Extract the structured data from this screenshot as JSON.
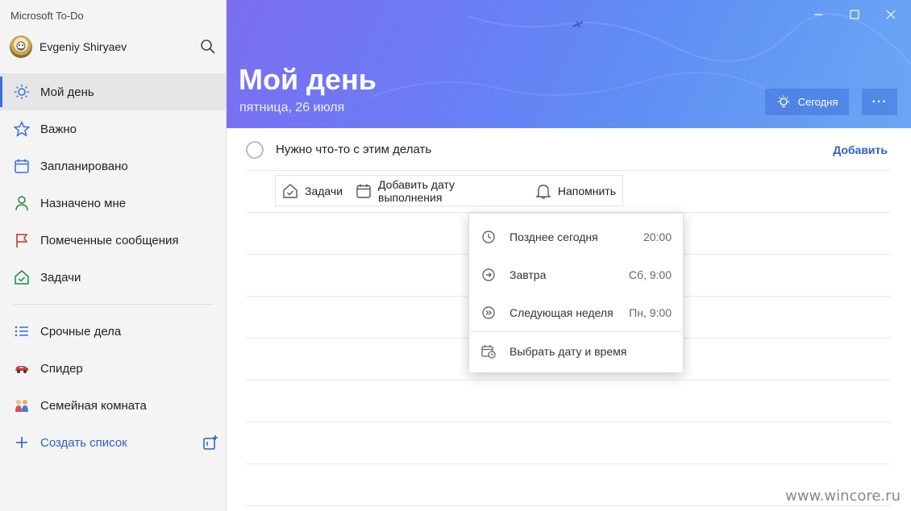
{
  "app": {
    "title": "Microsoft To-Do"
  },
  "user": {
    "name": "Evgeniy Shiryaev"
  },
  "sidebar": {
    "items": [
      {
        "label": "Мой день",
        "icon": "sun-icon",
        "active": true
      },
      {
        "label": "Важно",
        "icon": "star-icon"
      },
      {
        "label": "Запланировано",
        "icon": "calendar-icon"
      },
      {
        "label": "Назначено мне",
        "icon": "person-icon"
      },
      {
        "label": "Помеченные сообщения",
        "icon": "flag-icon"
      },
      {
        "label": "Задачи",
        "icon": "home-icon"
      }
    ],
    "lists": [
      {
        "label": "Срочные дела",
        "icon": "list-icon"
      },
      {
        "label": "Спидер",
        "icon": "car-emoji-icon"
      },
      {
        "label": "Семейная комната",
        "icon": "family-emoji-icon"
      }
    ],
    "create_list": "Создать список"
  },
  "header": {
    "title": "Мой день",
    "date": "пятница, 26 июля",
    "today_button": "Сегодня",
    "more_button": "···"
  },
  "task_input": {
    "value": "Нужно что-то с этим делать",
    "add_button": "Добавить"
  },
  "toolbar": {
    "tasks": "Задачи",
    "due_date": "Добавить дату выполнения",
    "remind": "Напомнить"
  },
  "reminder_menu": {
    "items": [
      {
        "label": "Позднее сегодня",
        "time": "20:00",
        "icon": "clock-icon"
      },
      {
        "label": "Завтра",
        "time": "Сб, 9:00",
        "icon": "arrow-circle-icon"
      },
      {
        "label": "Следующая неделя",
        "time": "Пн, 9:00",
        "icon": "double-arrow-circle-icon"
      }
    ],
    "custom": "Выбрать дату и время"
  },
  "watermark": "www.wincore.ru",
  "colors": {
    "accent": "#2f5fc7",
    "header_start": "#7b6ef0",
    "header_end": "#6aa7f4"
  }
}
